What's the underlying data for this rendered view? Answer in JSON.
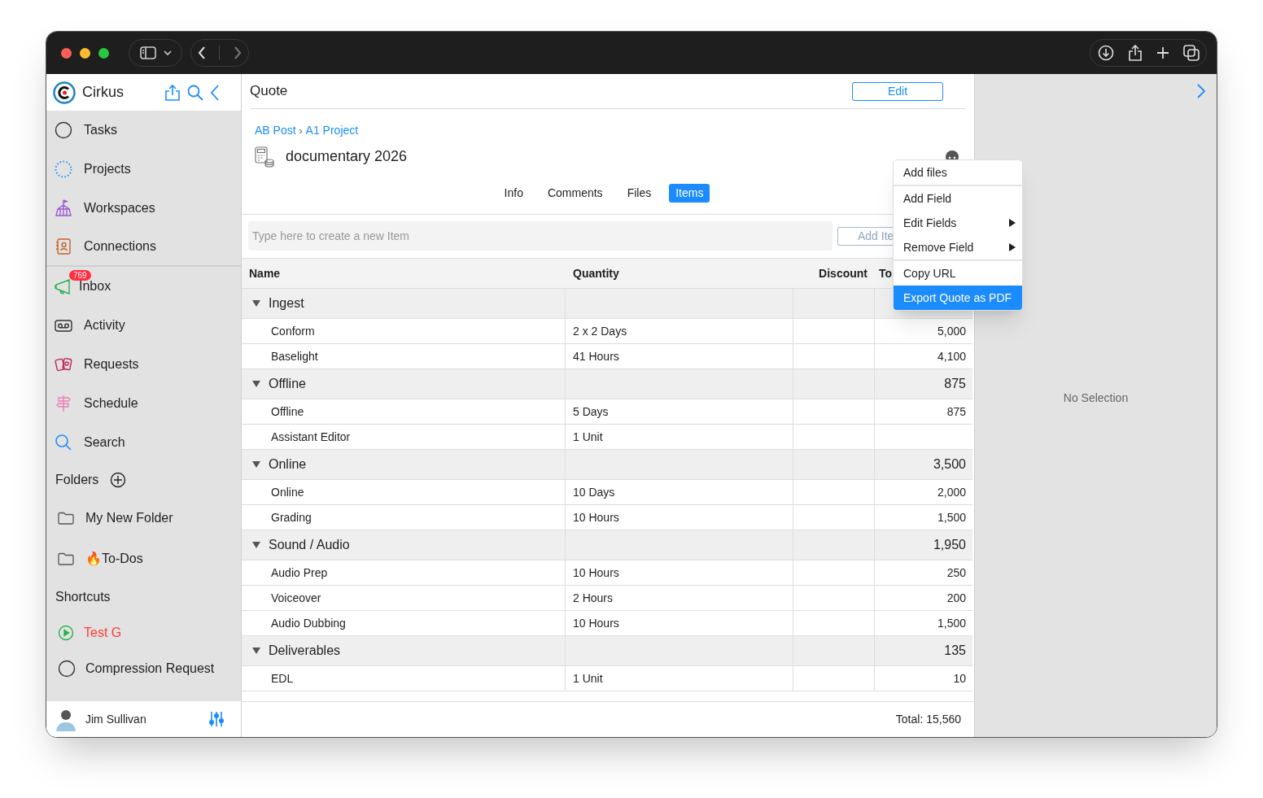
{
  "sidebar": {
    "app_name": "Cirkus",
    "nav_items": [
      {
        "label": "Tasks",
        "kind": "circle"
      },
      {
        "label": "Projects",
        "kind": "dotted"
      },
      {
        "label": "Workspaces",
        "kind": "tent"
      },
      {
        "label": "Connections",
        "kind": "contact"
      }
    ],
    "inbox": {
      "label": "Inbox",
      "badge": "769"
    },
    "items": [
      {
        "label": "Activity",
        "kind": "tape"
      },
      {
        "label": "Requests",
        "kind": "cards"
      },
      {
        "label": "Schedule",
        "kind": "signpost"
      },
      {
        "label": "Search",
        "kind": "search"
      }
    ],
    "folders_heading": "Folders",
    "folders": [
      "My New Folder",
      "🔥To-Dos"
    ],
    "shortcuts_heading": "Shortcuts",
    "shortcuts": [
      {
        "label": "Test G",
        "kind": "play",
        "color": "#ff3b30"
      },
      {
        "label": "Compression Request",
        "kind": "circle",
        "color": "#1f1f1f"
      }
    ],
    "user": "Jim Sullivan"
  },
  "main": {
    "title": "Quote",
    "edit_button": "Edit",
    "breadcrumb": [
      "AB Post",
      "A1 Project"
    ],
    "breadcrumb_separator": "›",
    "record_title": "documentary 2026",
    "tabs": [
      {
        "label": "Info",
        "selected": false
      },
      {
        "label": "Comments",
        "selected": false
      },
      {
        "label": "Files",
        "selected": false
      },
      {
        "label": "Items",
        "selected": true
      }
    ],
    "new_item": {
      "placeholder": "Type here to create a new Item",
      "button": "Add Ite"
    },
    "table": {
      "columns": [
        "Name",
        "Quantity",
        "Discount",
        "To"
      ],
      "groups": [
        {
          "name": "Ingest",
          "expanded": true,
          "rows": [
            {
              "name": "Conform",
              "quantity": "2 x 2 Days",
              "discount": "",
              "total": "5,000"
            },
            {
              "name": "Baselight",
              "quantity": "41 Hours",
              "discount": "",
              "total": "4,100"
            }
          ]
        },
        {
          "name": "Offline",
          "total": "875",
          "expanded": true,
          "rows": [
            {
              "name": "Offline",
              "quantity": "5 Days",
              "discount": "",
              "total": "875"
            },
            {
              "name": "Assistant Editor",
              "quantity": "1 Unit",
              "discount": "",
              "total": ""
            }
          ]
        },
        {
          "name": "Online",
          "total": "3,500",
          "expanded": true,
          "rows": [
            {
              "name": "Online",
              "quantity": "10 Days",
              "discount": "",
              "total": "2,000"
            },
            {
              "name": "Grading",
              "quantity": "10 Hours",
              "discount": "",
              "total": "1,500"
            }
          ]
        },
        {
          "name": "Sound / Audio",
          "total": "1,950",
          "expanded": true,
          "rows": [
            {
              "name": "Audio Prep",
              "quantity": "10 Hours",
              "discount": "",
              "total": "250"
            },
            {
              "name": "Voiceover",
              "quantity": "2 Hours",
              "discount": "",
              "total": "200"
            },
            {
              "name": "Audio Dubbing",
              "quantity": "10 Hours",
              "discount": "",
              "total": "1,500"
            }
          ]
        },
        {
          "name": "Deliverables",
          "total": "135",
          "expanded": true,
          "rows": [
            {
              "name": "EDL",
              "quantity": "1 Unit",
              "discount": "",
              "total": "10"
            }
          ]
        }
      ]
    },
    "footer_total": "Total: 15,560"
  },
  "context_menu": {
    "sections": [
      [
        {
          "label": "Add files",
          "submenu": false,
          "selected": false
        }
      ],
      [
        {
          "label": "Add Field",
          "submenu": false,
          "selected": false
        },
        {
          "label": "Edit Fields",
          "submenu": true,
          "selected": false
        },
        {
          "label": "Remove Field",
          "submenu": true,
          "selected": false
        }
      ],
      [
        {
          "label": "Copy URL",
          "submenu": false,
          "selected": false
        },
        {
          "label": "Export Quote as PDF",
          "submenu": false,
          "selected": true
        }
      ]
    ]
  },
  "detail_panel": {
    "empty_text": "No Selection"
  }
}
